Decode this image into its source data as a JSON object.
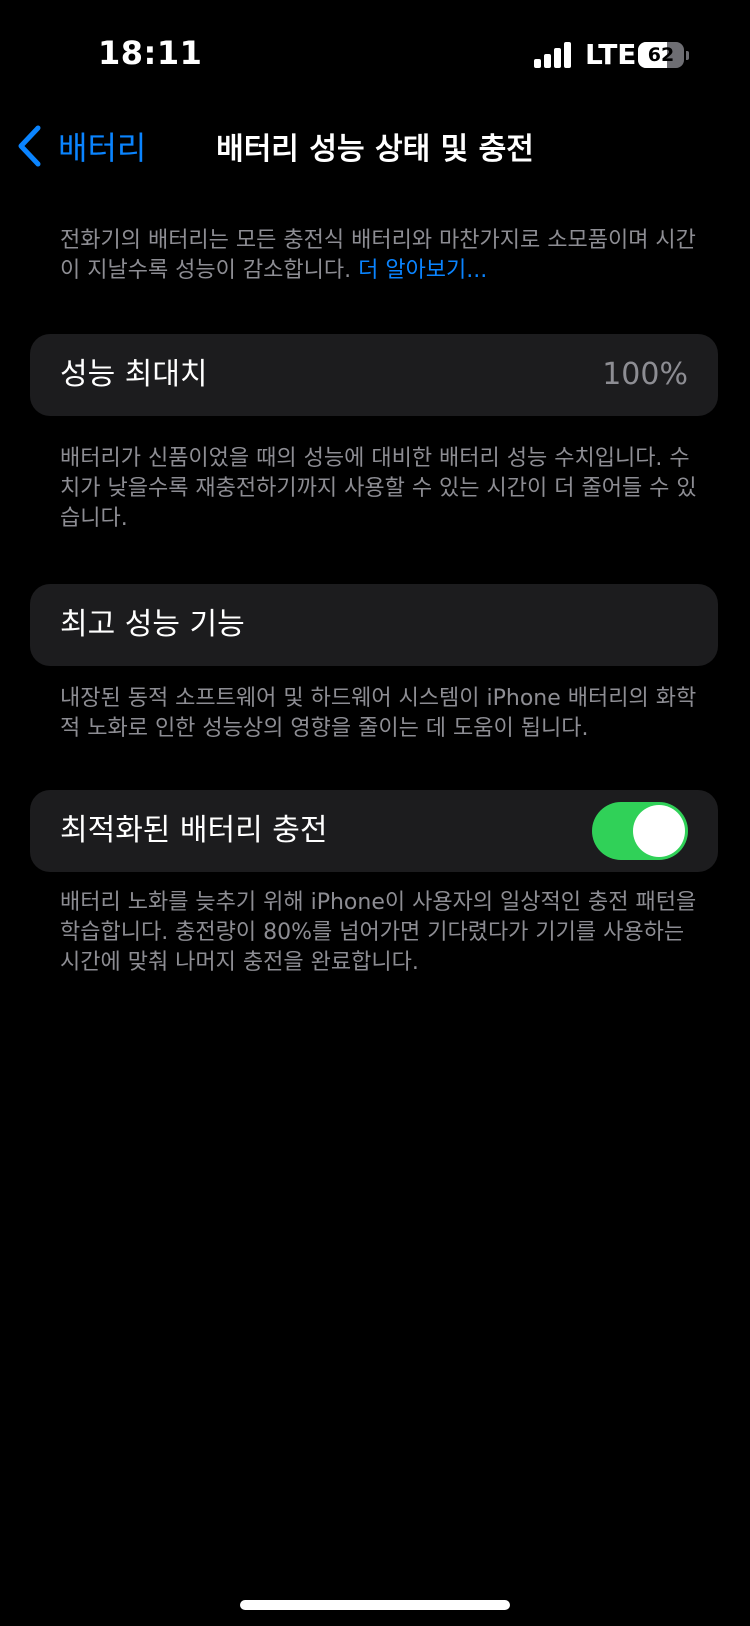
{
  "status_bar": {
    "time": "18:11",
    "network": "LTE",
    "battery_level": "62",
    "icons": [
      "signal-icon",
      "battery-icon"
    ]
  },
  "nav": {
    "back_label": "배터리",
    "back_icon": "chevron-left-icon",
    "title": "배터리 성능 상태 및 충전"
  },
  "intro": {
    "text": "전화기의 배터리는 모든 충전식 배터리와 마찬가지로 소모품이며 시간이 지날수록 성능이 감소합니다. ",
    "link": "더 알아보기..."
  },
  "max_capacity": {
    "label": "성능 최대치",
    "value": "100%",
    "footnote": "배터리가 신품이었을 때의 성능에 대비한 배터리 성능 수치입니다. 수치가 낮을수록 재충전하기까지 사용할 수 있는 시간이 더 줄어들 수 있습니다."
  },
  "peak_performance": {
    "label": "최고 성능 기능",
    "footnote": "내장된 동적 소프트웨어 및 하드웨어 시스템이 iPhone 배터리의 화학적 노화로 인한 성능상의 영향을 줄이는 데 도움이 됩니다."
  },
  "optimized_charging": {
    "label": "최적화된 배터리 충전",
    "enabled": true,
    "footnote": "배터리 노화를 늦추기 위해 iPhone이 사용자의 일상적인 충전 패턴을 학습합니다. 충전량이 80%를 넘어가면 기다렸다가 기기를 사용하는 시간에 맞춰 나머지 충전을 완료합니다."
  },
  "colors": {
    "background": "#000000",
    "cell": "#1c1c1e",
    "accent": "#0a84ff",
    "toggle_on": "#30d158",
    "secondary_text": "#8d8d93"
  }
}
